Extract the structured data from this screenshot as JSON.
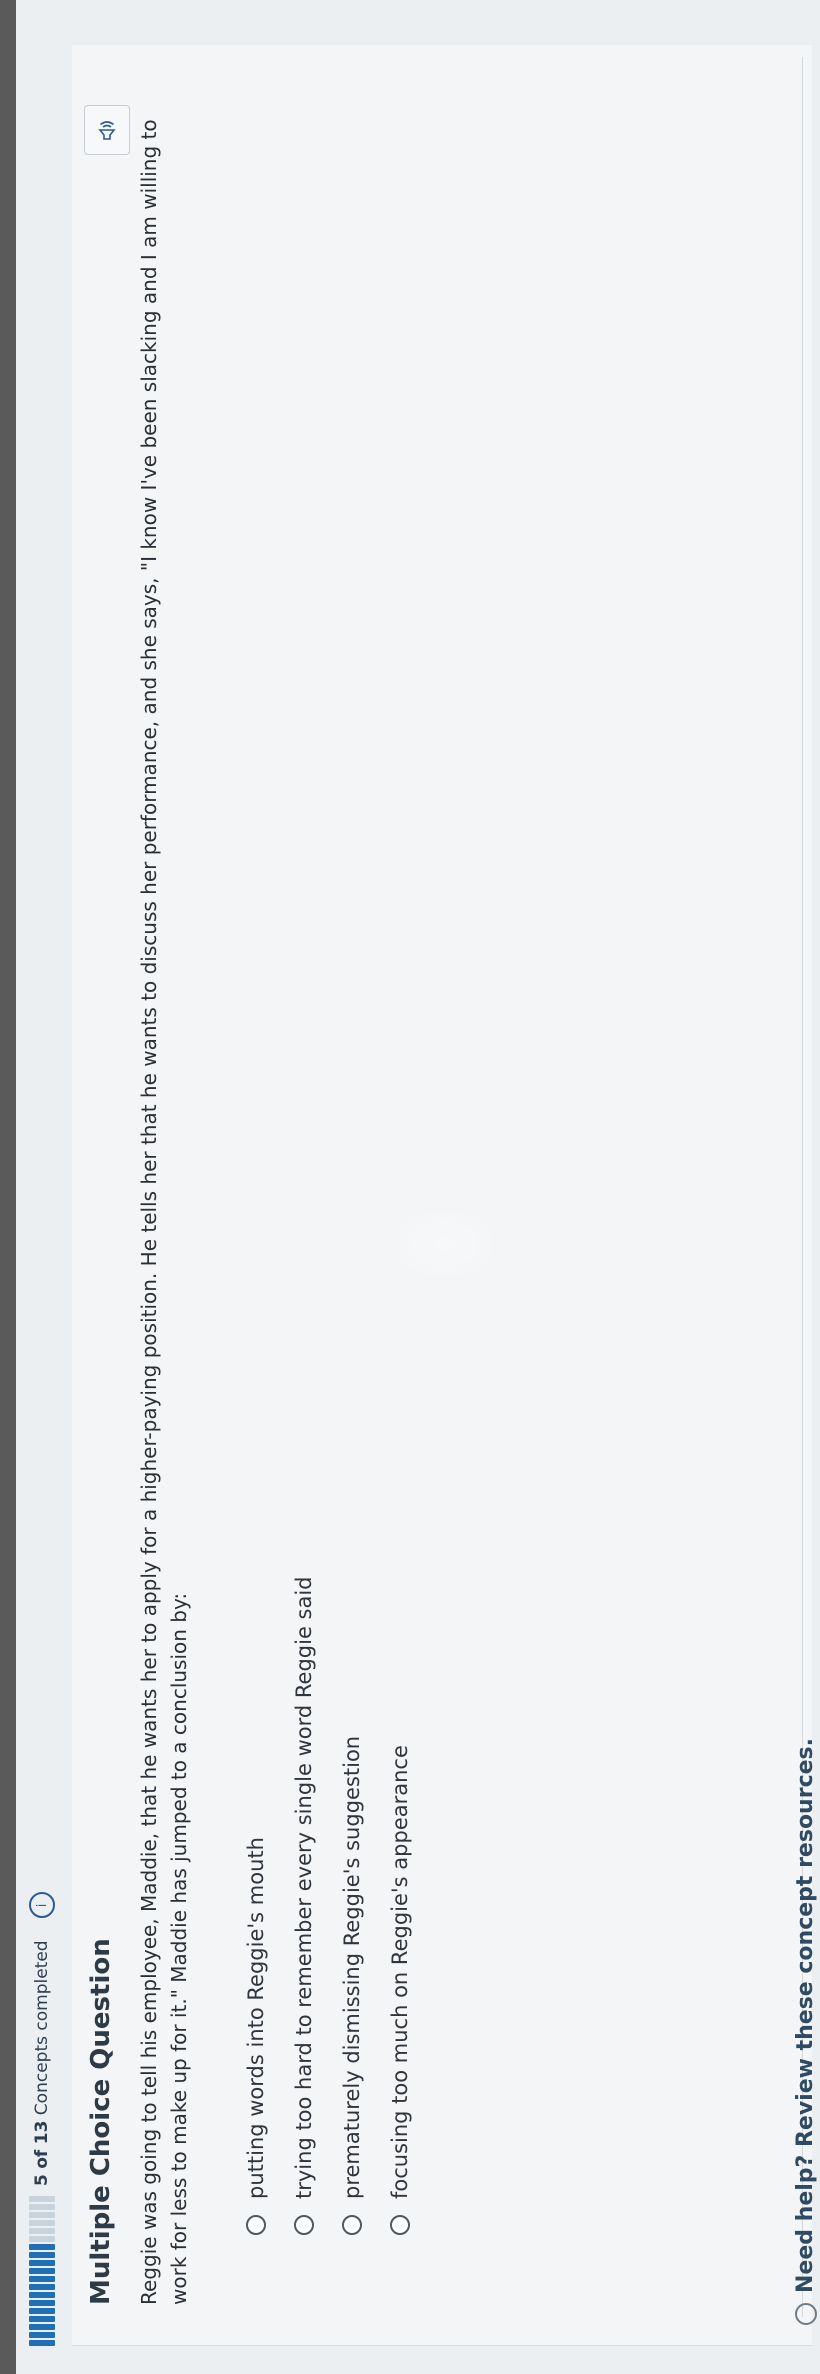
{
  "progress": {
    "filled_segments": 13,
    "empty_segments": 6,
    "completed": "5",
    "of_label": "of",
    "total": "13",
    "suffix": "Concepts completed",
    "info_icon": "i"
  },
  "question": {
    "heading": "Multiple Choice Question",
    "text": "Reggie was going to tell his employee, Maddie, that he wants her to apply for a higher-paying position. He tells her that he wants to discuss her performance, and she says, \"I know I've been slacking and I am willing to work for less to make up for it.\" Maddie has jumped to a conclusion by:",
    "speaker_icon": "speaker-icon"
  },
  "options": [
    {
      "label": "putting words into Reggie's mouth"
    },
    {
      "label": "trying too hard to remember every single word Reggie said"
    },
    {
      "label": "prematurely dismissing Reggie's suggestion"
    },
    {
      "label": "focusing too much on Reggie's appearance"
    }
  ],
  "help": {
    "text": "Need help? Review these concept resources."
  }
}
